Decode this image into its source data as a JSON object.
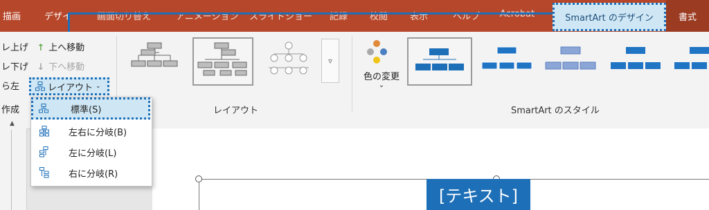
{
  "tabs": {
    "draw": "描画",
    "design": "デザイ",
    "transitions": "画面切り替え",
    "animations": "アニメーション",
    "slideshow": "スライドショー",
    "record": "記録",
    "review": "校閲",
    "view": "表示",
    "help": "ヘルプ",
    "acrobat": "Acrobat",
    "smartart_design": "SmartArt のデザイン",
    "format": "書式"
  },
  "ribbon": {
    "promote": "レ上げ",
    "demote": "レ下げ",
    "move_up": "上へ移動",
    "move_down": "下へ移動",
    "rtl": "ら左",
    "layout_button": "レイアウト",
    "create_group_label": "作成",
    "layouts_group_label": "レイアウト",
    "color_change": "色の変更",
    "styles_group_label": "SmartArt のスタイル"
  },
  "dropdown": {
    "items": [
      {
        "label": "標準(S)"
      },
      {
        "label": "左右に分岐(B)"
      },
      {
        "label": "左に分岐(L)"
      },
      {
        "label": "右に分岐(R)"
      }
    ]
  },
  "slide": {
    "text_placeholder": "[テキスト]"
  },
  "colors": {
    "tabbar": "#b7472a",
    "format_tab": "#9b3b22",
    "highlight": "#cfe7f5",
    "accent": "#1d6fb8"
  }
}
